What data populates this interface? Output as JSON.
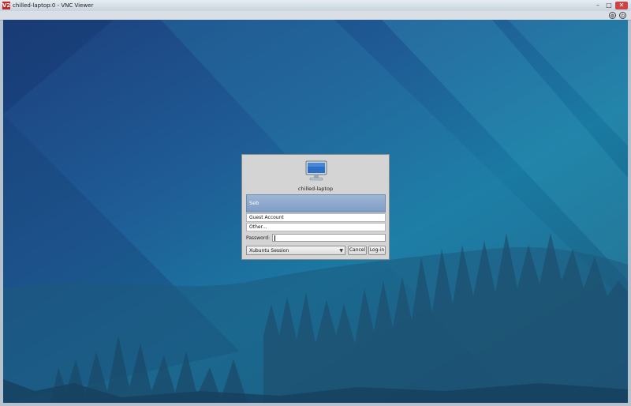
{
  "window": {
    "title": "chilled-laptop:0 - VNC Viewer",
    "app_icon_text": "V2",
    "minimize_glyph": "–",
    "maximize_glyph": "□",
    "close_glyph": "✕"
  },
  "toolbar": {
    "icons": [
      "options-icon",
      "close-connection-icon"
    ],
    "icon_glyphs": [
      "⚙",
      "⏻"
    ]
  },
  "login": {
    "hostname": "chilled-laptop",
    "users": {
      "selected": "Seb",
      "others": [
        "Guest Account",
        "Other..."
      ]
    },
    "password_label": "Password:",
    "password_value": "",
    "session": {
      "selected": "Xubuntu Session",
      "arrow": "▼"
    },
    "cancel_label": "Cancel",
    "login_label": "Log-in"
  },
  "colors": {
    "wallpaper_dark": "#1c3f7c",
    "wallpaper_light": "#1a7aa2",
    "selection": "#8ea9cc",
    "dialog_bg": "#d4d4d4"
  }
}
